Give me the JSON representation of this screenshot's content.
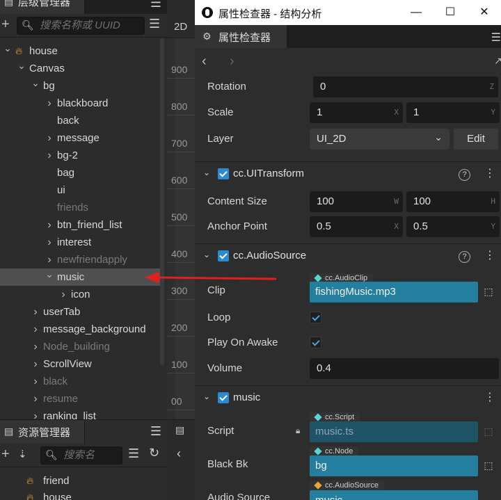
{
  "hierarchy": {
    "title": "层级管理器",
    "search_placeholder": "搜索名称或 UUID",
    "nodes": [
      {
        "label": "house",
        "depth": 0,
        "arrow": "down",
        "icon": "flame-icon",
        "dim": false,
        "selected": false
      },
      {
        "label": "Canvas",
        "depth": 1,
        "arrow": "down",
        "dim": false,
        "selected": false
      },
      {
        "label": "bg",
        "depth": 2,
        "arrow": "down",
        "dim": false,
        "selected": false
      },
      {
        "label": "blackboard",
        "depth": 3,
        "arrow": "right",
        "dim": false,
        "selected": false
      },
      {
        "label": "back",
        "depth": 3,
        "arrow": "",
        "dim": false,
        "selected": false
      },
      {
        "label": "message",
        "depth": 3,
        "arrow": "right",
        "dim": false,
        "selected": false
      },
      {
        "label": "bg-2",
        "depth": 3,
        "arrow": "right",
        "dim": false,
        "selected": false
      },
      {
        "label": "bag",
        "depth": 3,
        "arrow": "",
        "dim": false,
        "selected": false
      },
      {
        "label": "ui",
        "depth": 3,
        "arrow": "",
        "dim": false,
        "selected": false
      },
      {
        "label": "friends",
        "depth": 3,
        "arrow": "",
        "dim": true,
        "selected": false
      },
      {
        "label": "btn_friend_list",
        "depth": 3,
        "arrow": "right",
        "dim": false,
        "selected": false
      },
      {
        "label": "interest",
        "depth": 3,
        "arrow": "right",
        "dim": false,
        "selected": false
      },
      {
        "label": "newfriendapply",
        "depth": 3,
        "arrow": "right",
        "dim": true,
        "selected": false
      },
      {
        "label": "music",
        "depth": 3,
        "arrow": "down",
        "dim": false,
        "selected": true
      },
      {
        "label": "icon",
        "depth": 4,
        "arrow": "right",
        "dim": false,
        "selected": false
      },
      {
        "label": "userTab",
        "depth": 2,
        "arrow": "right",
        "dim": false,
        "selected": false
      },
      {
        "label": "message_background",
        "depth": 2,
        "arrow": "right",
        "dim": false,
        "selected": false
      },
      {
        "label": "Node_building",
        "depth": 2,
        "arrow": "right",
        "dim": true,
        "selected": false
      },
      {
        "label": "ScrollView",
        "depth": 2,
        "arrow": "right",
        "dim": false,
        "selected": false
      },
      {
        "label": "black",
        "depth": 2,
        "arrow": "right",
        "dim": true,
        "selected": false
      },
      {
        "label": "resume",
        "depth": 2,
        "arrow": "right",
        "dim": true,
        "selected": false
      },
      {
        "label": "ranking_list",
        "depth": 2,
        "arrow": "right",
        "dim": false,
        "selected": false
      }
    ]
  },
  "scene": {
    "mode_label": "2D",
    "ruler_labels": [
      "900",
      "800",
      "700",
      "600",
      "500",
      "400",
      "300",
      "200",
      "100",
      "00"
    ]
  },
  "assets": {
    "title": "资源管理器",
    "search_placeholder": "搜索名",
    "items": [
      "friend",
      "house"
    ]
  },
  "inspector": {
    "window_title": "属性检查器 - 结构分析",
    "tab_label": "属性检查器",
    "rotation": {
      "label": "Rotation",
      "value": "0",
      "axis": "Z"
    },
    "scale": {
      "label": "Scale",
      "x": "1",
      "x_axis": "X",
      "y": "1",
      "y_axis": "Y"
    },
    "layer": {
      "label": "Layer",
      "value": "UI_2D",
      "edit_label": "Edit"
    },
    "ui_transform": {
      "title": "cc.UITransform",
      "content_size": {
        "label": "Content Size",
        "w": "100",
        "w_axis": "W",
        "h": "100",
        "h_axis": "H"
      },
      "anchor_point": {
        "label": "Anchor Point",
        "x": "0.5",
        "x_axis": "X",
        "y": "0.5",
        "y_axis": "Y"
      }
    },
    "audio_source": {
      "title": "cc.AudioSource",
      "clip": {
        "label": "Clip",
        "type": "cc.AudioClip",
        "value": "fishingMusic.mp3"
      },
      "loop": {
        "label": "Loop",
        "checked": true
      },
      "play_on_awake": {
        "label": "Play On Awake",
        "checked": true
      },
      "volume": {
        "label": "Volume",
        "value": "0.4"
      }
    },
    "music": {
      "title": "music",
      "script": {
        "label": "Script",
        "type": "cc.Script",
        "value": "music.ts"
      },
      "black_bk": {
        "label": "Black Bk",
        "type": "cc.Node",
        "value": "bg"
      },
      "audio_source": {
        "label": "Audio Source",
        "type": "cc.AudioSource",
        "value": "music"
      }
    }
  },
  "colors": {
    "accent": "#2c8bd0",
    "asset_field": "#237f9d",
    "arrow": "#e02020",
    "flame": "#e8a33b"
  }
}
